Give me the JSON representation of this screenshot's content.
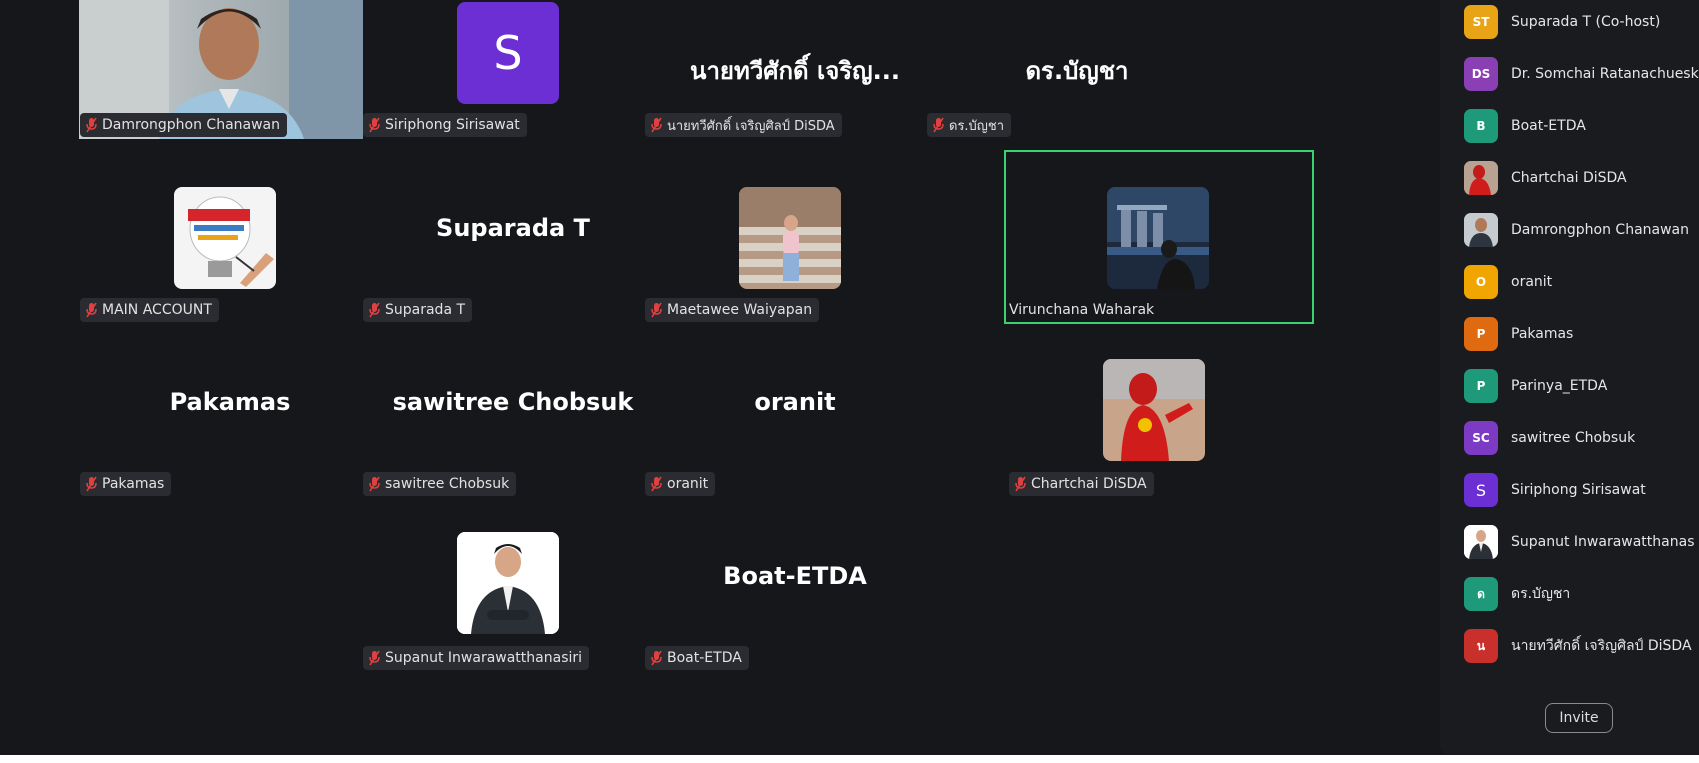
{
  "grid": {
    "tiles": [
      {
        "big": "",
        "tag": "Damrongphon Chanawan",
        "muted": true,
        "image": "webcam-video"
      },
      {
        "big": "",
        "tag": "Siriphong Sirisawat",
        "muted": true,
        "avatar_letter": "S"
      },
      {
        "big": "นายทวีศักดิ์ เจริญ...",
        "tag": "นายทวีศักดิ์ เจริญศิลป์ DiSDA",
        "muted": true
      },
      {
        "big": "ดร.บัญชา",
        "tag": "ดร.บัญชา",
        "muted": true
      },
      {
        "big": "",
        "tag": "MAIN ACCOUNT",
        "muted": true,
        "image": "project-lightbulb-picture"
      },
      {
        "big": "Suparada T",
        "tag": "Suparada T",
        "muted": true
      },
      {
        "big": "",
        "tag": "Maetawee Waiyapan",
        "muted": true,
        "image": "person-on-stairs-photo"
      },
      {
        "big": "",
        "tag": "Virunchana Waharak",
        "muted": false,
        "image": "night-city-photo",
        "active_speaker": true
      },
      {
        "big": "Pakamas",
        "tag": "Pakamas",
        "muted": true
      },
      {
        "big": "sawitree Chobsuk",
        "tag": "sawitree Chobsuk",
        "muted": true
      },
      {
        "big": "oranit",
        "tag": "oranit",
        "muted": true
      },
      {
        "big": "",
        "tag": "Chartchai DiSDA",
        "muted": true,
        "image": "superhero-costume-photo"
      },
      {
        "big": "",
        "tag": "Supanut Inwarawatthanasiri",
        "muted": true,
        "image": "man-in-suit-photo"
      },
      {
        "big": "Boat-ETDA",
        "tag": "Boat-ETDA",
        "muted": true
      }
    ]
  },
  "participants_panel": {
    "items": [
      {
        "initials": "ST",
        "name": "Suparada T (Co-host)",
        "color": "#e8a317"
      },
      {
        "initials": "DS",
        "name": "Dr. Somchai Ratanachuesk",
        "color": "#8a3fb5"
      },
      {
        "initials": "B",
        "name": "Boat-ETDA",
        "color": "#1e9a7a"
      },
      {
        "initials": "",
        "name": "Chartchai DiSDA",
        "color": "#a83a2a",
        "image": "superhero-avatar"
      },
      {
        "initials": "",
        "name": "Damrongphon Chanawan",
        "color": "#6b7785",
        "image": "person-avatar"
      },
      {
        "initials": "O",
        "name": "oranit",
        "color": "#f0a500"
      },
      {
        "initials": "P",
        "name": "Pakamas",
        "color": "#e06a10"
      },
      {
        "initials": "P",
        "name": "Parinya_ETDA",
        "color": "#1e9a7a"
      },
      {
        "initials": "SC",
        "name": "sawitree Chobsuk",
        "color": "#7d3bc5"
      },
      {
        "initials": "S",
        "name": "Siriphong Sirisawat",
        "color": "#6b2fd4"
      },
      {
        "initials": "",
        "name": "Supanut Inwarawatthanas",
        "color": "#ffffff",
        "image": "suit-avatar"
      },
      {
        "initials": "ด",
        "name": "ดร.บัญชา",
        "color": "#1e9a7a"
      },
      {
        "initials": "น",
        "name": "นายทวีศักดิ์ เจริญศิลป์ DiSDA",
        "color": "#c9302c"
      }
    ],
    "invite_label": "Invite"
  }
}
